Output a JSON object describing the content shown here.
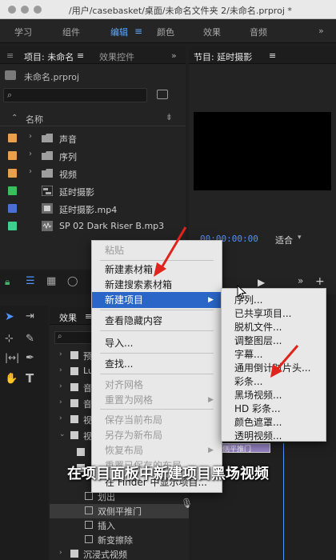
{
  "window": {
    "title": "/用户/casebasket/桌面/未命名文件夹 2/未命名.prproj *"
  },
  "workspaces": [
    "学习",
    "组件",
    "编辑",
    "颜色",
    "效果",
    "音频"
  ],
  "project_panel": {
    "tab_active": "项目: 未命名",
    "tab_other": "效果控件",
    "file_name": "未命名.prproj",
    "column_name": "名称",
    "items": [
      {
        "label": "声音",
        "type": "folder",
        "color": "#e8a04c"
      },
      {
        "label": "序列",
        "type": "folder",
        "color": "#e8a04c"
      },
      {
        "label": "视频",
        "type": "folder",
        "color": "#e8a04c"
      },
      {
        "label": "延时摄影",
        "type": "sequence",
        "color": "#3bbf5a"
      },
      {
        "label": "延时摄影.mp4",
        "type": "video",
        "color": "#4c6fd6"
      },
      {
        "label": "SP 02 Dark Riser B.mp3",
        "type": "audio",
        "color": "#3ccf8e"
      }
    ]
  },
  "program_panel": {
    "tab": "节目: 延时摄影",
    "timecode": "00:00:00:00",
    "fit": "适合"
  },
  "effects_panel": {
    "tab": "效果",
    "items": [
      "预",
      "Lu",
      "音",
      "音",
      "视",
      "视",
      "划出",
      "双侧平推门",
      "插入",
      "新变擦除",
      "沉浸式视频"
    ]
  },
  "context_menu": {
    "items": [
      "粘贴",
      "新建素材箱",
      "新建搜索素材箱",
      "新建项目",
      "查看隐藏内容",
      "导入...",
      "查找...",
      "对齐网格",
      "重置为网格",
      "保存当前布局",
      "另存为新布局",
      "恢复布局",
      "重置已保存的布局",
      "在 Finder 中显示项目..."
    ]
  },
  "submenu": {
    "items": [
      "序列...",
      "已共享项目...",
      "脱机文件...",
      "调整图层...",
      "字幕...",
      "通用倒计时片头...",
      "彩条...",
      "黑场视频...",
      "HD 彩条...",
      "颜色遮罩...",
      "透明视频..."
    ]
  },
  "timeline_clip": "双侧平推门",
  "subtitle": "在项目面板中新建项目黑场视频"
}
